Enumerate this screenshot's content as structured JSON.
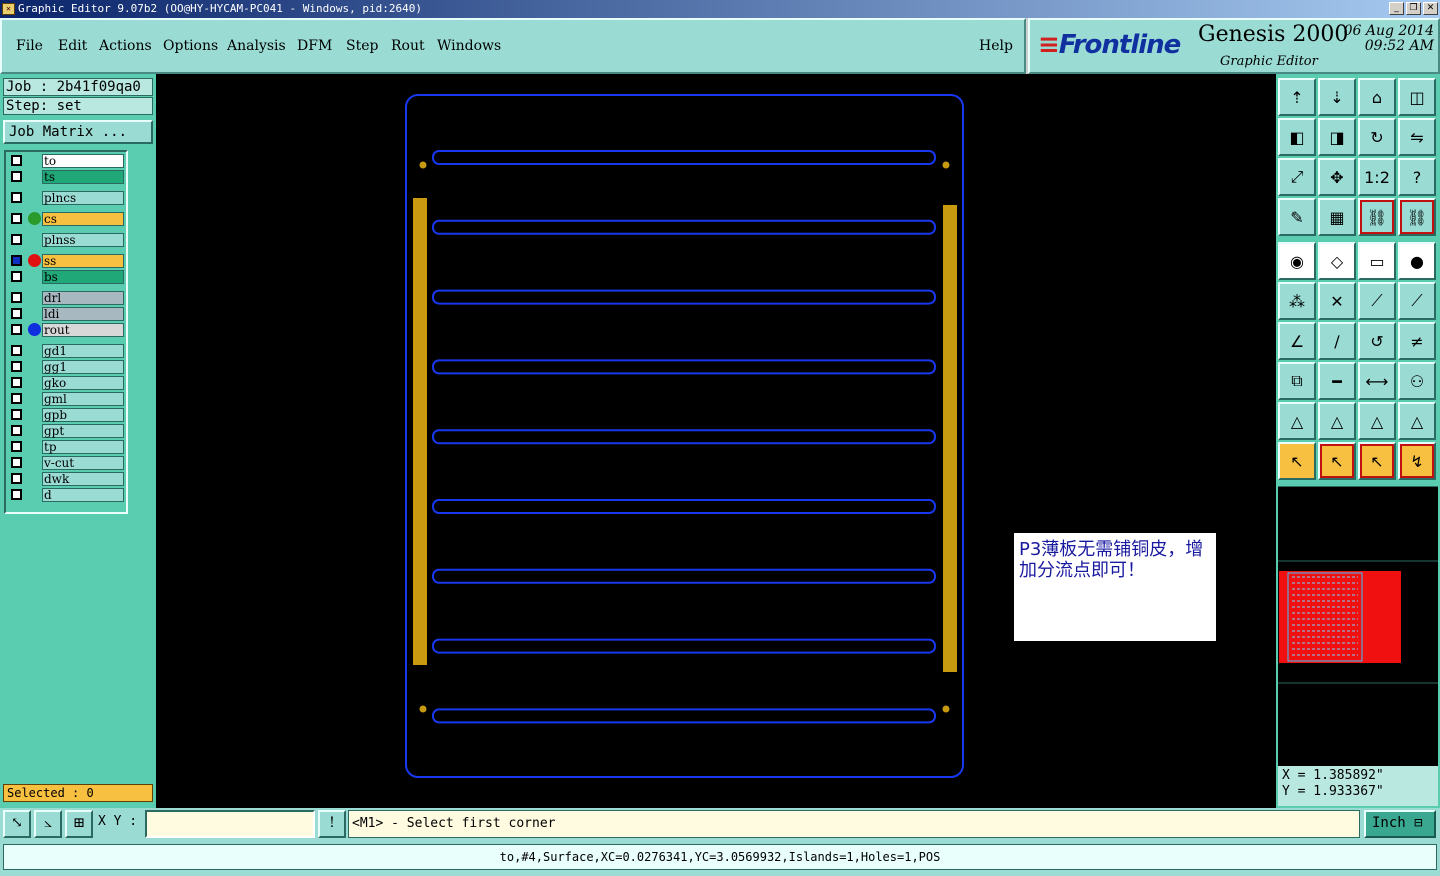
{
  "window": {
    "title": "Graphic Editor 9.07b2 (OO@HY-HYCAM-PC041 - Windows, pid:2640)",
    "controls": [
      "_",
      "❐",
      "✕"
    ]
  },
  "menu": {
    "items": [
      "File",
      "Edit",
      "Actions",
      "Options",
      "Analysis",
      "DFM",
      "Step",
      "Rout",
      "Windows"
    ],
    "help": "Help"
  },
  "brand": {
    "logo": "Frontline",
    "product": "Genesis 2000",
    "subtitle": "Graphic Editor",
    "date": "06 Aug 2014",
    "time": "09:52 AM"
  },
  "job": {
    "job_line": "Job : 2b41f09qa0",
    "step_line": "Step: set",
    "matrix_button": "Job Matrix ..."
  },
  "layers": [
    {
      "name": "to",
      "color": "#ffffff",
      "checked": false,
      "dot": ""
    },
    {
      "name": "ts",
      "color": "#20a878",
      "checked": false,
      "dot": ""
    },
    {
      "name": "plncs",
      "color": "#9adcd4",
      "checked": false,
      "dot": ""
    },
    {
      "name": "cs",
      "color": "#f8c040",
      "checked": false,
      "dot": "#2a9a2a"
    },
    {
      "name": "plnss",
      "color": "#9adcd4",
      "checked": false,
      "dot": ""
    },
    {
      "name": "ss",
      "color": "#f8c040",
      "checked": true,
      "dot": "#e01010"
    },
    {
      "name": "bs",
      "color": "#20a878",
      "checked": false,
      "dot": ""
    },
    {
      "name": "drl",
      "color": "#a8b8c0",
      "checked": false,
      "dot": ""
    },
    {
      "name": "ldi",
      "color": "#a8b8c0",
      "checked": false,
      "dot": ""
    },
    {
      "name": "rout",
      "color": "#d8d8d8",
      "checked": false,
      "dot": "#1030e0"
    },
    {
      "name": "gd1",
      "color": "#9adcd4",
      "checked": false,
      "dot": ""
    },
    {
      "name": "gg1",
      "color": "#9adcd4",
      "checked": false,
      "dot": ""
    },
    {
      "name": "gko",
      "color": "#9adcd4",
      "checked": false,
      "dot": ""
    },
    {
      "name": "gml",
      "color": "#9adcd4",
      "checked": false,
      "dot": ""
    },
    {
      "name": "gpb",
      "color": "#9adcd4",
      "checked": false,
      "dot": ""
    },
    {
      "name": "gpt",
      "color": "#9adcd4",
      "checked": false,
      "dot": ""
    },
    {
      "name": "tp",
      "color": "#9adcd4",
      "checked": false,
      "dot": ""
    },
    {
      "name": "v-cut",
      "color": "#9adcd4",
      "checked": false,
      "dot": ""
    },
    {
      "name": "dwk",
      "color": "#9adcd4",
      "checked": false,
      "dot": ""
    },
    {
      "name": "d",
      "color": "#9adcd4",
      "checked": false,
      "dot": ""
    }
  ],
  "selected": "Selected : 0",
  "note": "P3薄板无需铺铜皮，增加分流点即可！",
  "coords": {
    "x": "X = 1.385892\"",
    "y": "Y = 1.933367\""
  },
  "toolbar_icons": [
    "home-up-icon",
    "home-down-icon",
    "house-icon",
    "window-split-icon",
    "arrow-left-box-icon",
    "arrow-right-box-icon",
    "rotate-icon",
    "mirror-icon",
    "fit-icon",
    "center-icon",
    "scale-1-2-icon",
    "help-question-icon",
    "tools-icon",
    "grid-icon",
    "snap-red-icon",
    "snap-red2-icon",
    "pad-icon",
    "shape-icon",
    "ruler-icon",
    "dot-icon",
    "nodes-icon",
    "cross-icon",
    "line-point-icon",
    "line-point2-icon",
    "angle-icon",
    "slash-icon",
    "arc-icon",
    "flip-icon",
    "copy-icon",
    "dash-icon",
    "measure-icon",
    "group-icon",
    "triangle-icon",
    "triangle-a-icon",
    "triangle-b-icon",
    "triangle-c-icon",
    "select-arrow-icon",
    "select-box-icon",
    "select-circle-icon",
    "select-path-icon"
  ],
  "bottom": {
    "xy_label": "X Y :",
    "xy_value": "",
    "message": "<M1> - Select first corner",
    "unit": "Inch",
    "status": "to,#4,Surface,XC=0.0276341,YC=3.0569932,Islands=1,Holes=1,POS"
  }
}
